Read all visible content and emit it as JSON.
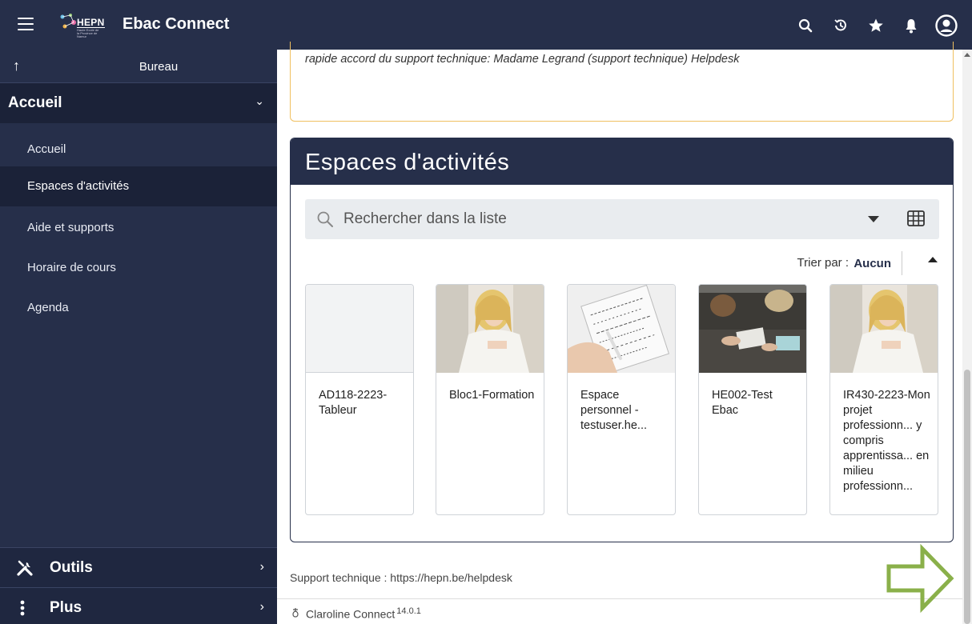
{
  "header": {
    "logo_text": "HEPN",
    "logo_subtext": "Haute Ecole de la Province de Namur",
    "app_title": "Ebac Connect"
  },
  "sidebar": {
    "back_label": "Bureau",
    "section_label": "Accueil",
    "items": [
      {
        "label": "Accueil",
        "active": false
      },
      {
        "label": "Espaces d'activités",
        "active": true
      },
      {
        "label": "Aide et supports",
        "active": false
      },
      {
        "label": "Horaire de cours",
        "active": false
      },
      {
        "label": "Agenda",
        "active": false
      }
    ],
    "bottom": [
      {
        "label": "Outils",
        "icon": "tools-icon"
      },
      {
        "label": "Plus",
        "icon": "more-vertical-icon"
      }
    ]
  },
  "notice": {
    "text": "rapide accord du support technique: Madame Legrand (support technique) Helpdesk"
  },
  "panel": {
    "title": "Espaces d'activités",
    "search_placeholder": "Rechercher dans la liste",
    "sort_label": "Trier par :",
    "sort_value": "Aucun"
  },
  "cards": [
    {
      "title": "AD118-2223-Tableur",
      "thumb": "none"
    },
    {
      "title": "Bloc1-Formation",
      "thumb": "woman"
    },
    {
      "title": "Espace personnel - testuser.he...",
      "thumb": "notebook"
    },
    {
      "title": "HE002-Test Ebac",
      "thumb": "group"
    },
    {
      "title": "IR430-2223-Mon projet professionn... y compris apprentissa... en milieu professionn...",
      "thumb": "woman"
    }
  ],
  "footer": {
    "support": "Support technique : https://hepn.be/helpdesk",
    "product": "Claroline Connect",
    "version": "14.0.1"
  },
  "colors": {
    "brand_dark": "#262f4a",
    "accent_arrow": "#8ab04a",
    "notice_border": "#f0c060"
  }
}
